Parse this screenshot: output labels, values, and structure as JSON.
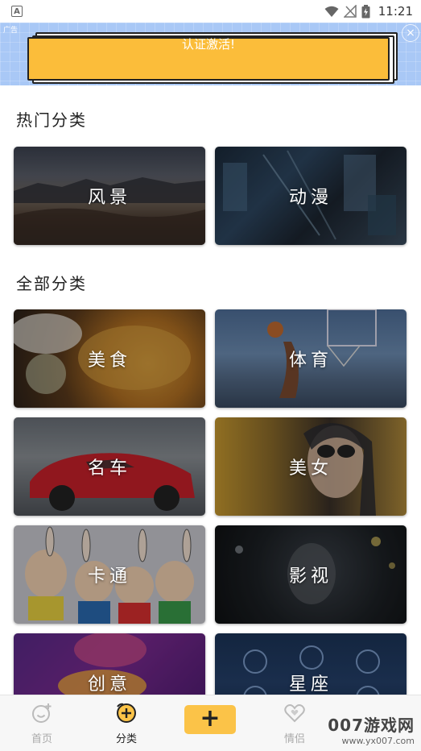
{
  "status_bar": {
    "time": "11:21",
    "app_icon_letter": "A"
  },
  "ad": {
    "label": "广告",
    "text": "认证激活!",
    "close": "×"
  },
  "hot_section": {
    "title": "热门分类",
    "items": [
      {
        "label": "风景",
        "theme": "landscape"
      },
      {
        "label": "动漫",
        "theme": "anime"
      }
    ]
  },
  "all_section": {
    "title": "全部分类",
    "items": [
      {
        "label": "美食",
        "theme": "food"
      },
      {
        "label": "体育",
        "theme": "sports"
      },
      {
        "label": "名车",
        "theme": "cars"
      },
      {
        "label": "美女",
        "theme": "beauty"
      },
      {
        "label": "卡通",
        "theme": "cartoon"
      },
      {
        "label": "影视",
        "theme": "film"
      },
      {
        "label": "创意",
        "theme": "creative"
      },
      {
        "label": "星座",
        "theme": "zodiac"
      }
    ]
  },
  "bottom_nav": {
    "items": [
      {
        "label": "首页",
        "icon": "smile-plus-icon",
        "active": false
      },
      {
        "label": "分类",
        "icon": "category-icon",
        "active": true
      },
      {
        "label": "+",
        "icon": "add-icon",
        "active": false
      },
      {
        "label": "情侣",
        "icon": "heart-icon",
        "active": false
      }
    ]
  },
  "watermark": {
    "line1": "007游戏网",
    "line2": "www.yx007.com"
  },
  "colors": {
    "accent": "#fbc348",
    "ad_bg": "#a9c8f6",
    "ad_card": "#fbbd3a"
  }
}
